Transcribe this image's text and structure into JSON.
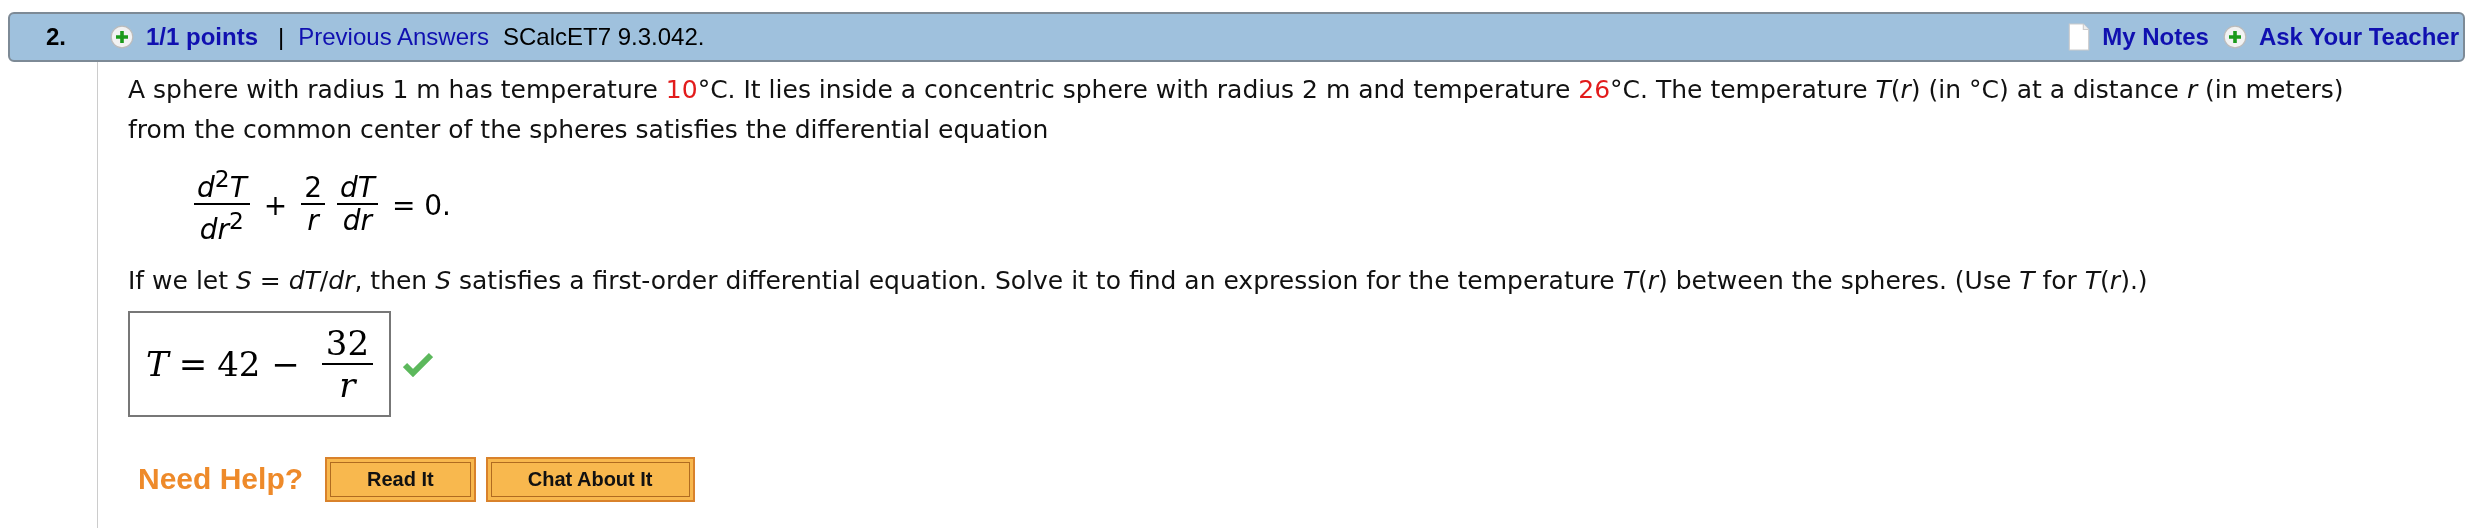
{
  "question": {
    "number": "2.",
    "points": "1/1 points",
    "separator": "|",
    "previous_answers": "Previous Answers",
    "reference": "SCalcET7 9.3.042.",
    "my_notes": "My Notes",
    "ask_teacher": "Ask Your Teacher"
  },
  "intro": [
    {
      "text": "A sphere with radius 1 m has temperature ",
      "red": false
    },
    {
      "text": "10",
      "red": true
    },
    {
      "text": "°C. It lies inside a concentric sphere with radius 2 m and temperature ",
      "red": false
    },
    {
      "text": "26",
      "red": true
    },
    {
      "text": "°C. The temperature *T*(*r*) (in °C) at a distance *r* (in meters) from the common center of the spheres satisfies the differential equation",
      "red": false
    }
  ],
  "equation": [
    {
      "kind": "fraction",
      "num": "*d*$^{2}$*T*",
      "den": "*dr*$^{2}$"
    },
    {
      "kind": "op",
      "text": "+"
    },
    {
      "kind": "fraction",
      "num": "2",
      "den": "*r*"
    },
    {
      "kind": "fraction",
      "num": "*dT*",
      "den": "*dr*"
    },
    {
      "kind": "op",
      "text": "= 0."
    }
  ],
  "instruction": "If we let *S* = *dT*/*dr*, then *S* satisfies a first-order differential equation. Solve it to find an expression for the temperature *T*(*r*) between the spheres. (Use *T* for *T*(*r*).)",
  "answer": {
    "lhs": "T",
    "eq": "=",
    "rhs": "42 −",
    "num": "32",
    "den": "r",
    "correct": true
  },
  "help": {
    "label": "Need Help?",
    "buttons": [
      "Read It",
      "Chat About It"
    ]
  }
}
